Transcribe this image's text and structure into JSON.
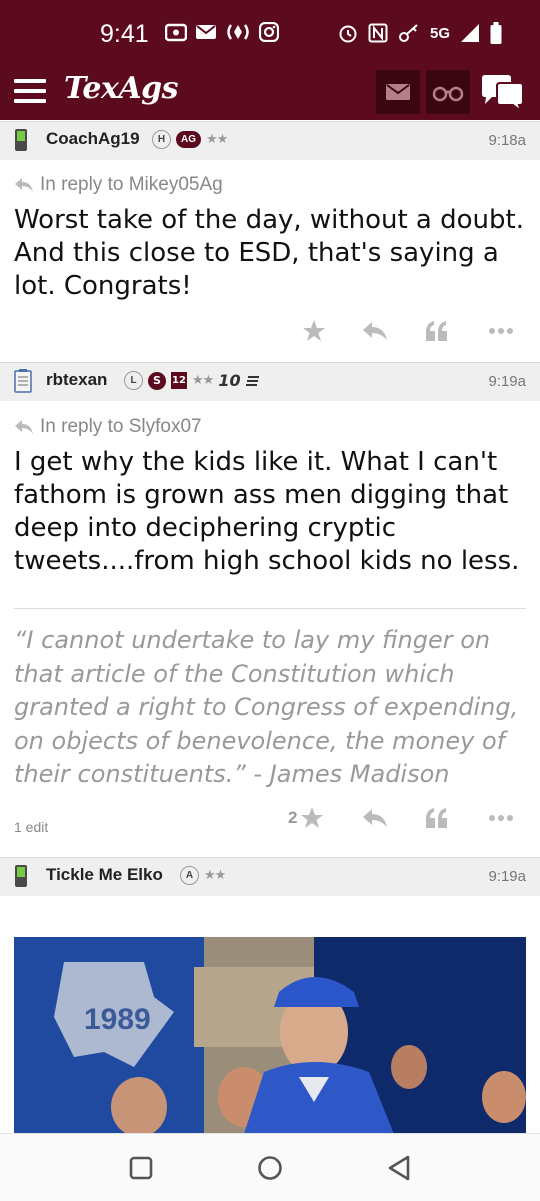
{
  "status_bar": {
    "time": "9:41",
    "network": "5G"
  },
  "app_bar": {
    "logo": "TexAgs",
    "icons": [
      "menu-icon",
      "mail-icon",
      "binoculars-icon",
      "chat-icon"
    ]
  },
  "posts": [
    {
      "username": "CoachAg19",
      "badges": [
        "H",
        "AG"
      ],
      "stars": "★★",
      "time": "9:18a",
      "reply_to": "In reply to Mikey05Ag",
      "body": "Worst take of the day, without a doubt. And this close to ESD, that's saying a lot. Congrats!"
    },
    {
      "username": "rbtexan",
      "badges": [
        "L",
        "S",
        "12"
      ],
      "stars": "★★",
      "extra_badge": "10",
      "time": "9:19a",
      "reply_to": "In reply to Slyfox07",
      "body": "I get why the kids like it. What I can't fathom is grown ass men digging that deep into deciphering cryptic tweets....from high school kids no less.",
      "signature": "“I cannot undertake to lay my finger on that article of the Constitution which granted a right to Congress of expending, on objects of benevolence, the money of their constituents.” - James Madison",
      "edit_note": "1 edit",
      "star_count": "2"
    },
    {
      "username": "Tickle Me Elko",
      "badges": [
        "A"
      ],
      "stars": "★★",
      "time": "9:19a",
      "image_banner_text": "1989"
    }
  ],
  "colors": {
    "brand": "#5c0a1e",
    "header_bg": "#efefef",
    "muted": "#999999"
  }
}
